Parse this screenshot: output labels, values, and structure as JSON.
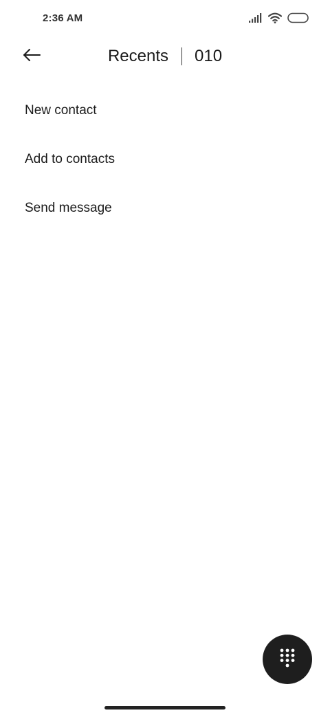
{
  "status_bar": {
    "time": "2:36 AM",
    "icons": [
      "signal-icon",
      "wifi-icon",
      "battery-icon"
    ]
  },
  "header": {
    "back_icon": "back-arrow-icon",
    "title": "Recents",
    "number": "010"
  },
  "menu": {
    "items": [
      {
        "label": "New contact"
      },
      {
        "label": "Add to contacts"
      },
      {
        "label": "Send message"
      }
    ]
  },
  "fab": {
    "icon": "dialpad-icon",
    "color": "#1e1e1e"
  }
}
